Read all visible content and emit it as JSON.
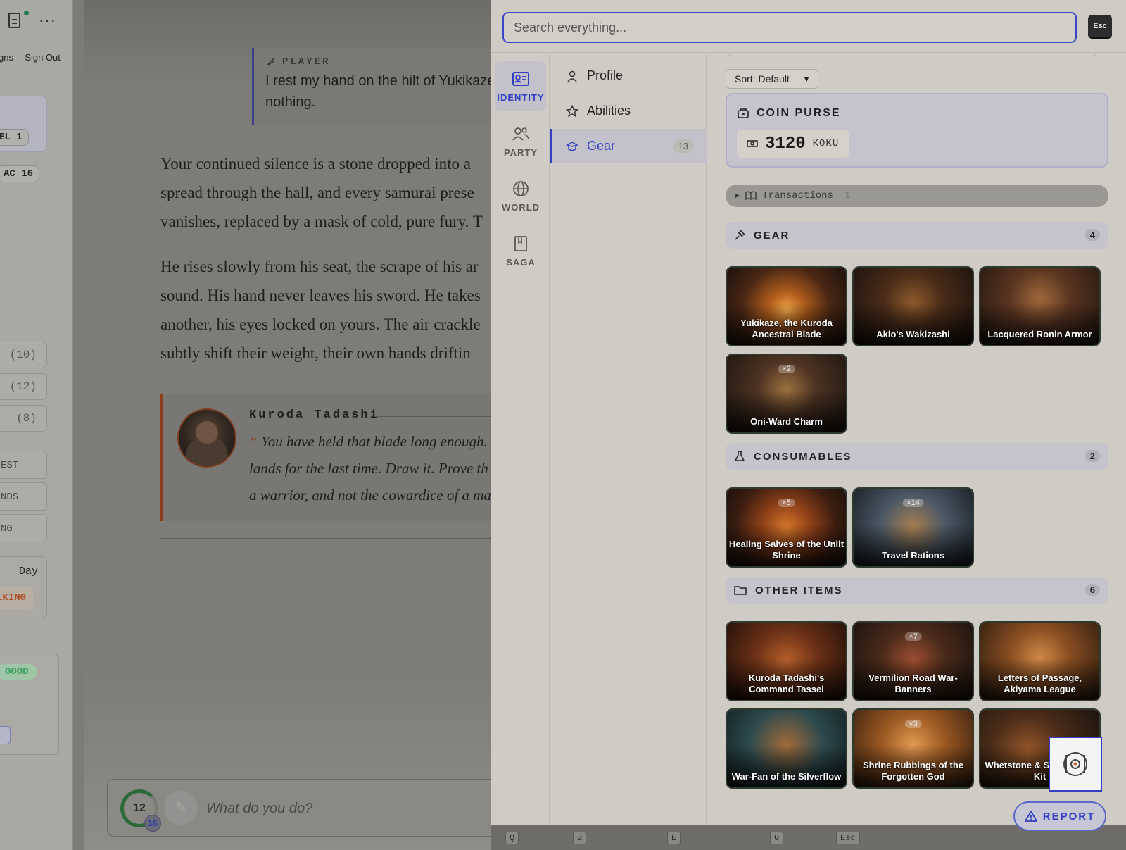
{
  "left_sidebar": {
    "links": [
      "gns",
      "Sign Out"
    ],
    "level_chip": "EL 1",
    "ac_chip": "AC 16",
    "stats": [
      "(10)",
      "(12)",
      "(8)"
    ],
    "buttons": [
      "EST",
      "NDS",
      "NG"
    ],
    "day_label": "Day",
    "walking_badge": "LKING",
    "status_badge": "GOOD",
    "small_button": "e"
  },
  "story": {
    "player_label": "PLAYER",
    "player_text": "I rest my hand on the hilt of Yukikaze nothing.",
    "paragraph1": [
      "Your continued silence is a stone dropped into a",
      "spread through the hall, and every samurai prese",
      "vanishes, replaced by a mask of cold, pure fury. T"
    ],
    "paragraph2": [
      "He rises slowly from his seat, the scrape of his ar",
      "sound. His hand never leaves his sword. He takes",
      "another, his eyes locked on yours. The air crackle",
      "subtly shift their weight, their own hands driftin"
    ],
    "speaker_name": "Kuroda Tadashi",
    "quote_mark": "“",
    "quote_lines": [
      "You have held that blade long enough.",
      "lands for the last time. Draw it. Prove th",
      "a warrior, and not the cowardice of a ma"
    ],
    "input_placeholder": "What do you do?",
    "progress_value": "12",
    "progress_max": "16",
    "progress_fraction": 0.75
  },
  "panel": {
    "search_placeholder": "Search everything...",
    "esc_label": "Esc",
    "rail": [
      {
        "label": "IDENTITY",
        "icon": "id-card-icon",
        "active": true
      },
      {
        "label": "PARTY",
        "icon": "people-icon",
        "active": false
      },
      {
        "label": "WORLD",
        "icon": "globe-icon",
        "active": false
      },
      {
        "label": "SAGA",
        "icon": "book-icon",
        "active": false
      }
    ],
    "subnav": [
      {
        "label": "Profile",
        "icon": "person-icon"
      },
      {
        "label": "Abilities",
        "icon": "star-icon"
      },
      {
        "label": "Gear",
        "icon": "gear-hat-icon",
        "count": "13",
        "active": true
      }
    ],
    "sort_label": "Sort: Default",
    "coin_purse": {
      "title": "COIN PURSE",
      "value": "3120",
      "unit": "KOKU"
    },
    "transactions": {
      "label": "Transactions",
      "count": "1"
    },
    "sections": {
      "gear": {
        "title": "GEAR",
        "count": "4"
      },
      "consumables": {
        "title": "CONSUMABLES",
        "count": "2"
      },
      "other": {
        "title": "OTHER ITEMS",
        "count": "6"
      }
    },
    "gear_items": [
      {
        "name": "Yukikaze, the Kuroda Ancestral Blade",
        "qty": ""
      },
      {
        "name": "Akio's Wakizashi",
        "qty": ""
      },
      {
        "name": "Lacquered Ronin Armor",
        "qty": ""
      },
      {
        "name": "Oni-Ward Charm",
        "qty": "×2"
      }
    ],
    "consumable_items": [
      {
        "name": "Healing Salves of the Unlit Shrine",
        "qty": "×5"
      },
      {
        "name": "Travel Rations",
        "qty": "×14"
      }
    ],
    "other_items": [
      {
        "name": "Kuroda Tadashi's Command Tassel",
        "qty": ""
      },
      {
        "name": "Vermilion Road War-Banners",
        "qty": "×7"
      },
      {
        "name": "Letters of Passage, Akiyama League",
        "qty": ""
      },
      {
        "name": "War-Fan of the Silverflow",
        "qty": ""
      },
      {
        "name": "Shrine Rubbings of the Forgotten God",
        "qty": "×3"
      },
      {
        "name": "Whetstone & Sword-Care Kit",
        "qty": ""
      }
    ],
    "shortcuts": [
      "Q",
      "B",
      "E",
      "G",
      "Esc"
    ],
    "report_label": "REPORT",
    "accent_color": "#3340c5"
  }
}
